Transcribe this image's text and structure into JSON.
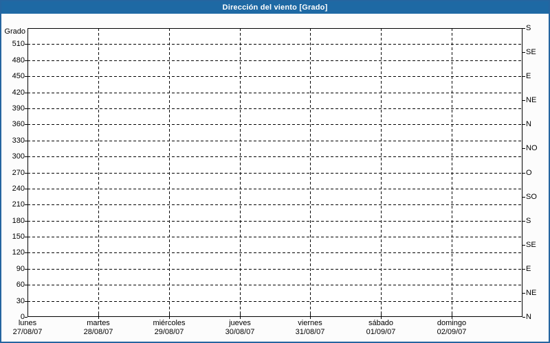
{
  "window": {
    "title": "Dirección del viento [Grado]"
  },
  "colors": {
    "title_bar_bg": "#1e69a4",
    "title_text": "#ffffff",
    "frame_border": "#2565a0",
    "page_bg": "#fcfcfc",
    "plot_bg": "#ffffff",
    "grid_line": "#000000",
    "axis_line": "#000000",
    "label_text": "#000000"
  },
  "chart_data": {
    "type": "line",
    "title": "Dirección del viento [Grado]",
    "ylabel_left": "Grado",
    "ylim": [
      0,
      540
    ],
    "y_tick_step": 30,
    "y_ticks": [
      0,
      30,
      60,
      90,
      120,
      150,
      180,
      210,
      240,
      270,
      300,
      330,
      360,
      390,
      420,
      450,
      480,
      510
    ],
    "right_axis_ticks": [
      {
        "deg": 540,
        "label": "S"
      },
      {
        "deg": 495,
        "label": "SE"
      },
      {
        "deg": 450,
        "label": "E"
      },
      {
        "deg": 405,
        "label": "NE"
      },
      {
        "deg": 360,
        "label": "N"
      },
      {
        "deg": 315,
        "label": "NO"
      },
      {
        "deg": 270,
        "label": "O"
      },
      {
        "deg": 225,
        "label": "SO"
      },
      {
        "deg": 180,
        "label": "S"
      },
      {
        "deg": 135,
        "label": "SE"
      },
      {
        "deg": 90,
        "label": "E"
      },
      {
        "deg": 45,
        "label": "NE"
      },
      {
        "deg": 0,
        "label": "N"
      }
    ],
    "x_categories": [
      {
        "day": "lunes",
        "date": "27/08/07"
      },
      {
        "day": "martes",
        "date": "28/08/07"
      },
      {
        "day": "miércoles",
        "date": "29/08/07"
      },
      {
        "day": "jueves",
        "date": "30/08/07"
      },
      {
        "day": "viernes",
        "date": "31/08/07"
      },
      {
        "day": "sábado",
        "date": "01/09/07"
      },
      {
        "day": "domingo",
        "date": "02/09/07"
      }
    ],
    "series": [],
    "grid": "dashed",
    "legend": "none"
  }
}
